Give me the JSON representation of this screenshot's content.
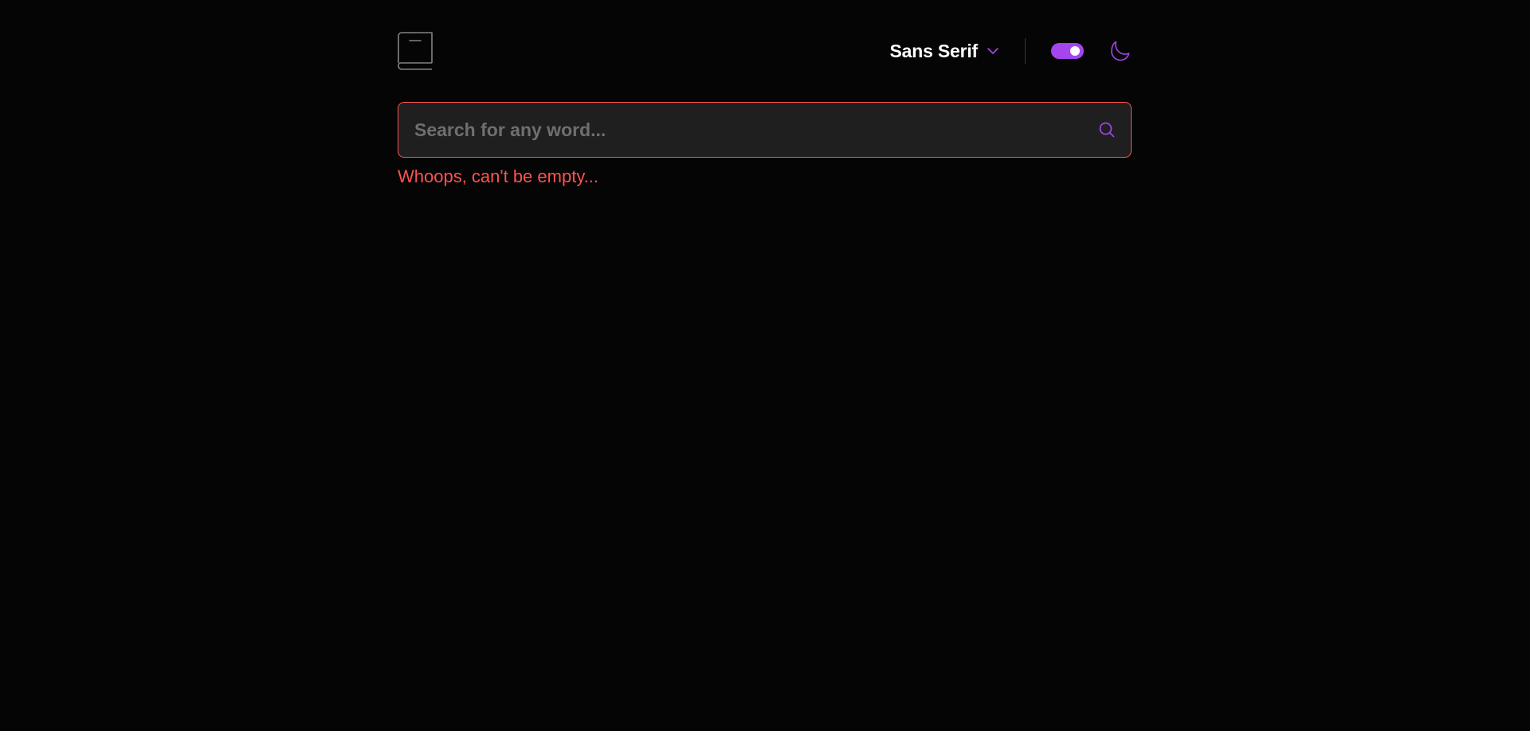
{
  "header": {
    "logo_icon": "book-icon",
    "font_selector": {
      "selected": "Sans Serif",
      "icon": "chevron-down-icon"
    },
    "theme_toggle": {
      "state": "on",
      "icon": "moon-icon"
    }
  },
  "search": {
    "placeholder": "Search for any word...",
    "value": "",
    "icon": "search-icon",
    "error": "Whoops, can't be empty..."
  },
  "colors": {
    "background": "#050505",
    "accent": "#a445ed",
    "error": "#ff5252",
    "input_background": "#1f1f1f",
    "placeholder": "#6f6f6f",
    "logo": "#838383"
  }
}
